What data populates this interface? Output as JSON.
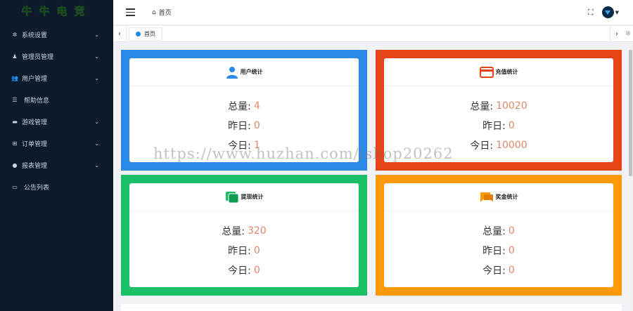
{
  "sidebar": {
    "logo": "牛牛电竞",
    "items": [
      {
        "label": "系统设置",
        "icon": "gear-icon",
        "glyph": "✲",
        "has_arrow": true
      },
      {
        "label": "管理员管理",
        "icon": "person-icon",
        "glyph": "♟",
        "has_arrow": true
      },
      {
        "label": "用户管理",
        "icon": "users-icon",
        "glyph": "👥",
        "has_arrow": true
      },
      {
        "label": "帮助信息",
        "icon": "list-icon",
        "glyph": "☰",
        "has_arrow": false
      },
      {
        "label": "游戏管理",
        "icon": "gamepad-icon",
        "glyph": "▬",
        "has_arrow": true
      },
      {
        "label": "订单管理",
        "icon": "cart-icon",
        "glyph": "⊞",
        "has_arrow": true
      },
      {
        "label": "报表管理",
        "icon": "chart-icon",
        "glyph": "●",
        "has_arrow": true
      },
      {
        "label": "公告列表",
        "icon": "notice-icon",
        "glyph": "▭",
        "has_arrow": false
      }
    ]
  },
  "header": {
    "breadcrumb": "首页"
  },
  "tabs": {
    "items": [
      {
        "label": "首页"
      }
    ]
  },
  "cards": [
    {
      "title": "用户统计",
      "icon": "user-icon",
      "color": "#2b8ae6",
      "total_label": "总量:",
      "total": "4",
      "yesterday_label": "昨日:",
      "yesterday": "0",
      "today_label": "今日:",
      "today": "1"
    },
    {
      "title": "充值统计",
      "icon": "credit-card-icon",
      "color": "#e64316",
      "total_label": "总量:",
      "total": "10020",
      "yesterday_label": "昨日:",
      "yesterday": "0",
      "today_label": "今日:",
      "today": "10000"
    },
    {
      "title": "提现统计",
      "icon": "layers-icon",
      "color": "#1abf68",
      "total_label": "总量:",
      "total": "320",
      "yesterday_label": "昨日:",
      "yesterday": "0",
      "today_label": "今日:",
      "today": "0"
    },
    {
      "title": "奖金统计",
      "icon": "chat-bubbles-icon",
      "color": "#fb9a06",
      "total_label": "总量:",
      "total": "0",
      "yesterday_label": "昨日:",
      "yesterday": "0",
      "today_label": "今日:",
      "today": "0"
    }
  ],
  "watermark": "https://www.huzhan.com/ishop20262"
}
